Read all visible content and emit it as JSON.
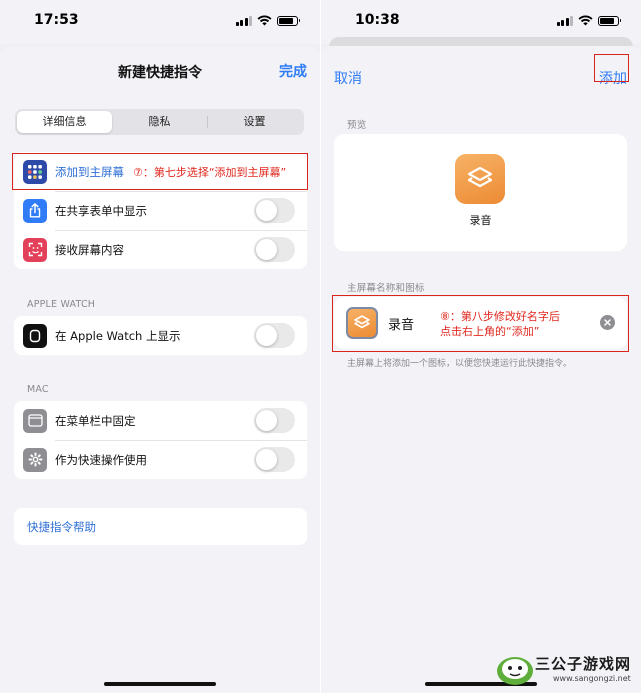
{
  "left": {
    "status": {
      "time": "17:53"
    },
    "header": {
      "title": "新建快捷指令",
      "done": "完成"
    },
    "segments": [
      "详细信息",
      "隐私",
      "设置"
    ],
    "group1": {
      "add_home": "添加到主屏幕",
      "share_sheet": "在共享表单中显示",
      "receive_screen": "接收屏幕内容"
    },
    "annotation7": "⑦：第七步选择“添加到主屏幕”",
    "apple_watch": {
      "heading": "APPLE WATCH",
      "show_on_watch": "在 Apple Watch 上显示"
    },
    "mac": {
      "heading": "MAC",
      "pin_menu": "在菜单栏中固定",
      "quick_action": "作为快速操作使用"
    },
    "help": "快捷指令帮助"
  },
  "right": {
    "status": {
      "time": "10:38"
    },
    "header": {
      "cancel": "取消",
      "add": "添加"
    },
    "preview_heading": "预览",
    "preview_name": "录音",
    "name_heading": "主屏幕名称和图标",
    "name_value": "录音",
    "annotation8_line1": "⑧：第八步修改好名字后",
    "annotation8_line2": "点击右上角的“添加”",
    "footnote": "主屏幕上将添加一个图标，以便您快速运行此快捷指令。"
  },
  "watermark": {
    "title": "三公子游戏网",
    "url": "www.sangongzi.net"
  },
  "colors": {
    "accent": "#2f7cf6",
    "annotation": "#d9261c",
    "shortcut_icon": "#ec8b34"
  }
}
